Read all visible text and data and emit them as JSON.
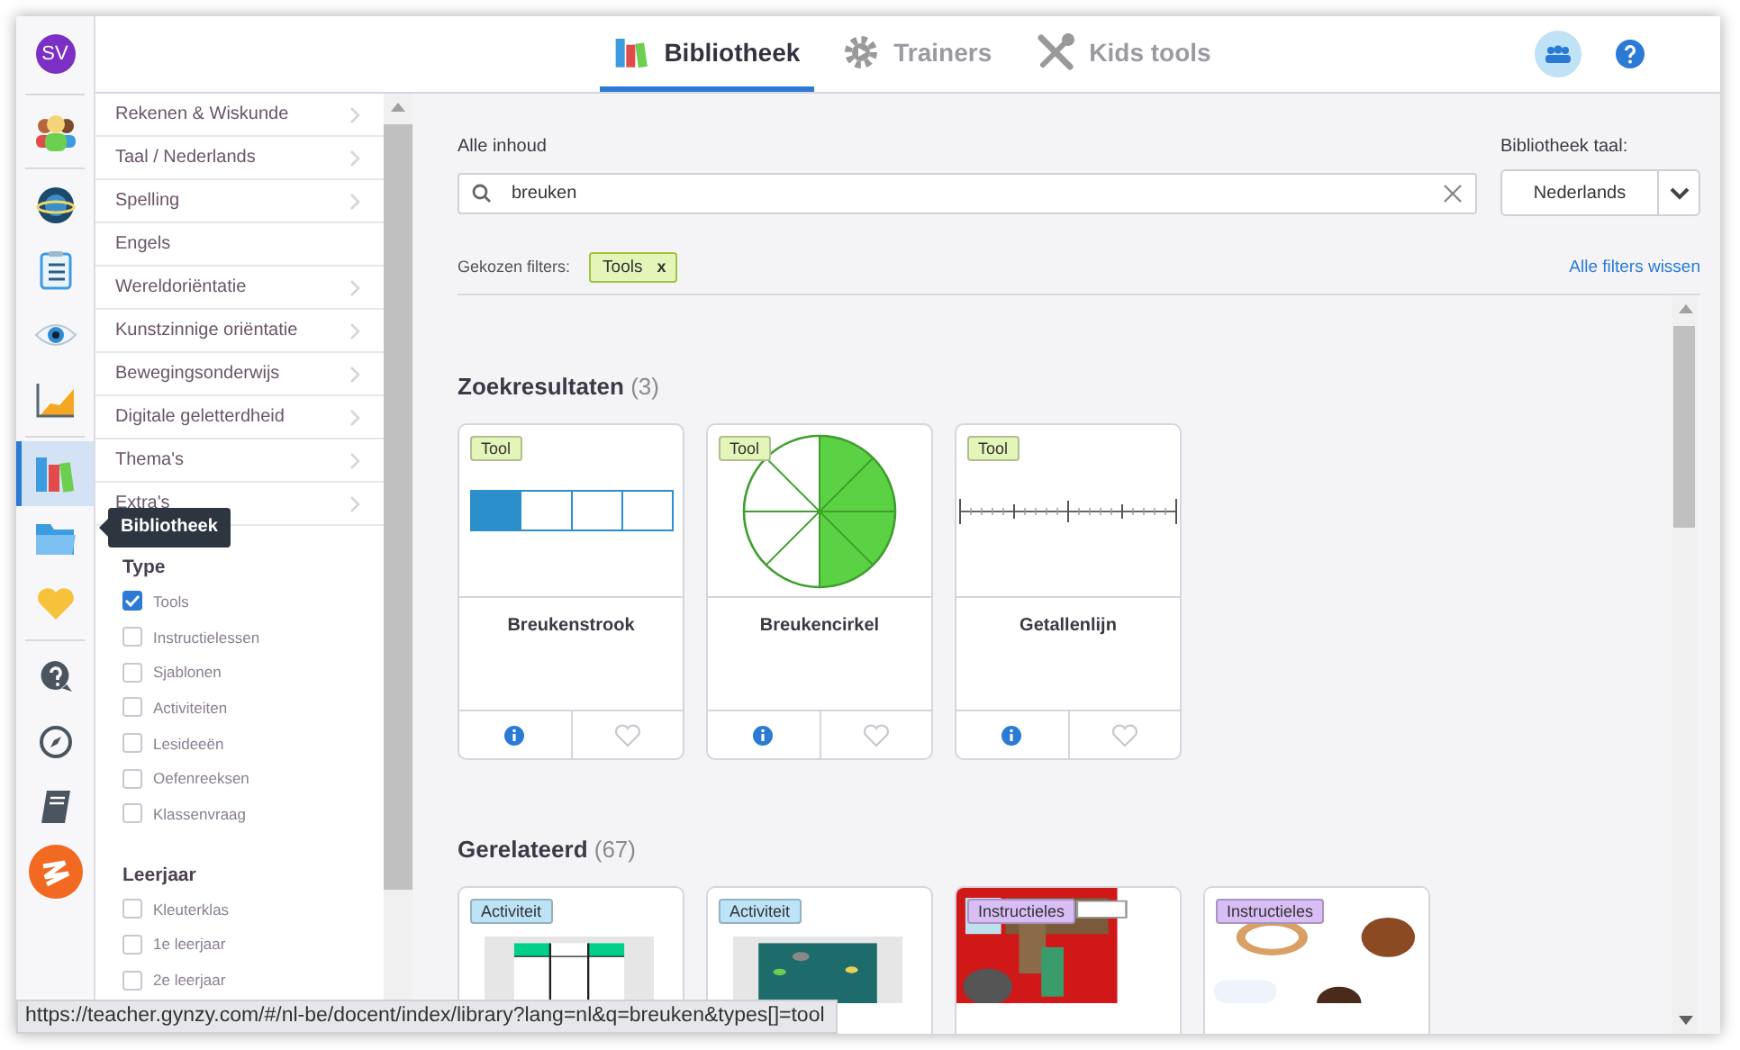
{
  "rail": {
    "groups": [
      {
        "items": [
          {
            "kind": "avatar",
            "initials": "SV",
            "selected": false
          }
        ]
      },
      {
        "items": [
          {
            "kind": "users",
            "selected": false
          }
        ]
      },
      {
        "items": [
          {
            "kind": "planet",
            "selected": false
          },
          {
            "kind": "clipboard",
            "selected": false
          },
          {
            "kind": "eye",
            "selected": false
          },
          {
            "kind": "chart",
            "selected": false
          }
        ]
      },
      {
        "items": [
          {
            "kind": "books",
            "selected": true
          },
          {
            "kind": "folder",
            "selected": false
          },
          {
            "kind": "heart",
            "selected": false
          }
        ]
      },
      {
        "items": [
          {
            "kind": "help",
            "selected": false
          },
          {
            "kind": "compass",
            "selected": false
          },
          {
            "kind": "book",
            "selected": false
          },
          {
            "kind": "logo",
            "selected": false
          }
        ]
      }
    ]
  },
  "tooltip": "Bibliotheek",
  "tabs": [
    {
      "label": "Bibliotheek",
      "kind": "books",
      "selected": true
    },
    {
      "label": "Trainers",
      "kind": "gear",
      "selected": false
    },
    {
      "label": "Kids tools",
      "kind": "tools",
      "selected": false
    }
  ],
  "categories": [
    {
      "label": "Rekenen & Wiskunde",
      "arrow": true
    },
    {
      "label": "Taal / Nederlands",
      "arrow": true
    },
    {
      "label": "Spelling",
      "arrow": true
    },
    {
      "label": "Engels",
      "arrow": false
    },
    {
      "label": "Wereldoriëntatie",
      "arrow": true
    },
    {
      "label": "Kunstzinnige oriëntatie",
      "arrow": true
    },
    {
      "label": "Bewegingsonderwijs",
      "arrow": true
    },
    {
      "label": "Digitale geletterdheid",
      "arrow": true
    },
    {
      "label": "Thema's",
      "arrow": true
    },
    {
      "label": "Extra's",
      "arrow": true
    }
  ],
  "filter_groups": [
    {
      "title": "Type",
      "options": [
        {
          "label": "Tools",
          "checked": true
        },
        {
          "label": "Instructielessen",
          "checked": false
        },
        {
          "label": "Sjablonen",
          "checked": false
        },
        {
          "label": "Activiteiten",
          "checked": false
        },
        {
          "label": "Lesideeën",
          "checked": false
        },
        {
          "label": "Oefenreeksen",
          "checked": false
        },
        {
          "label": "Klassenvraag",
          "checked": false
        }
      ]
    },
    {
      "title": "Leerjaar",
      "options": [
        {
          "label": "Kleuterklas",
          "checked": false
        },
        {
          "label": "1e leerjaar",
          "checked": false
        },
        {
          "label": "2e leerjaar",
          "checked": false
        }
      ]
    }
  ],
  "search": {
    "label": "Alle inhoud",
    "value": "breuken"
  },
  "language": {
    "label": "Bibliotheek taal:",
    "value": "Nederlands"
  },
  "chosen_filters": {
    "label": "Gekozen filters:",
    "chips": [
      "Tools"
    ],
    "chip_close": "x",
    "clear_all": "Alle filters wissen"
  },
  "results": {
    "title": "Zoekresultaten",
    "count": "(3)",
    "cards": [
      {
        "tag": "Tool",
        "color": "#e3f5b8",
        "title": "Breukenstrook",
        "kind": "strip"
      },
      {
        "tag": "Tool",
        "color": "#e3f5b8",
        "title": "Breukencirkel",
        "kind": "circle"
      },
      {
        "tag": "Tool",
        "color": "#e3f5b8",
        "title": "Getallenlijn",
        "kind": "numberline"
      }
    ]
  },
  "related": {
    "title": "Gerelateerd",
    "count": "(67)",
    "cards": [
      {
        "tag": "Activiteit",
        "color": "#bde3f7",
        "kind": "picture"
      },
      {
        "tag": "Activiteit",
        "color": "#bde3f7",
        "kind": "picture"
      },
      {
        "tag": "Instructieles",
        "color": "#d9bdf5",
        "kind": "picture"
      },
      {
        "tag": "Instructieles",
        "color": "#d9bdf5",
        "kind": "picture"
      }
    ]
  },
  "status_url": "https://teacher.gynzy.com/#/nl-be/docent/index/library?lang=nl&q=breuken&types[]=tool"
}
